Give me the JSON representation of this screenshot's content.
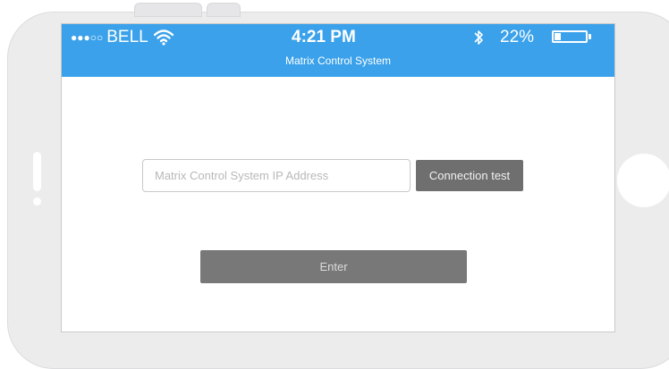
{
  "status_bar": {
    "signal_dots": "●●●○○",
    "carrier": "BELL",
    "time": "4:21 PM",
    "battery_percent": "22%",
    "battery_level": 0.22,
    "background_color": "#3aa1ea"
  },
  "app": {
    "title": "Matrix Control System"
  },
  "form": {
    "ip_input_placeholder": "Matrix Control System IP Address",
    "ip_input_value": "",
    "connection_test_label": "Connection test",
    "enter_label": "Enter"
  },
  "icons": {
    "wifi": "wifi-icon",
    "bluetooth": "bluetooth-icon",
    "battery": "battery-icon"
  }
}
